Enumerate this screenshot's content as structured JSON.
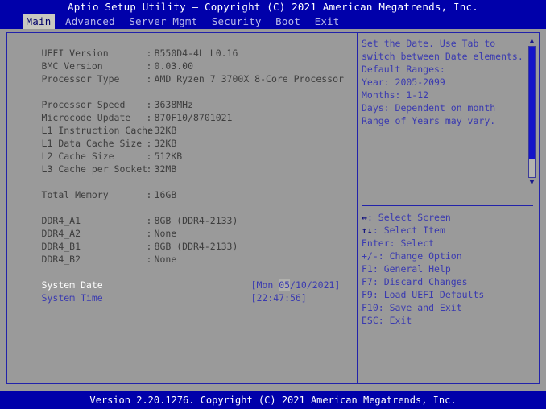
{
  "titlebar": {
    "text": "Aptio Setup Utility – Copyright (C) 2021 American Megatrends, Inc."
  },
  "menubar": {
    "items": [
      {
        "label": "Main",
        "active": true
      },
      {
        "label": "Advanced",
        "active": false
      },
      {
        "label": "Server Mgmt",
        "active": false
      },
      {
        "label": "Security",
        "active": false
      },
      {
        "label": "Boot",
        "active": false
      },
      {
        "label": "Exit",
        "active": false
      }
    ]
  },
  "main": {
    "info_rows": [
      {
        "label": "UEFI Version",
        "value": "B550D4-4L L0.16"
      },
      {
        "label": "BMC Version",
        "value": "0.03.00"
      },
      {
        "label": "Processor Type",
        "value": "AMD Ryzen 7 3700X 8-Core Processor"
      }
    ],
    "cpu_rows": [
      {
        "label": "Processor Speed",
        "value": "3638MHz"
      },
      {
        "label": "Microcode Update",
        "value": "870F10/8701021"
      },
      {
        "label": "L1 Instruction Cache",
        "value": "32KB"
      },
      {
        "label": "L1 Data Cache Size",
        "value": "32KB"
      },
      {
        "label": "L2 Cache Size",
        "value": "512KB"
      },
      {
        "label": "L3 Cache per Socket",
        "value": "32MB"
      }
    ],
    "memory_total": {
      "label": "Total Memory",
      "value": "16GB"
    },
    "dimm_rows": [
      {
        "label": "DDR4_A1",
        "value": "8GB (DDR4-2133)"
      },
      {
        "label": "DDR4_A2",
        "value": "None"
      },
      {
        "label": "DDR4_B1",
        "value": "8GB (DDR4-2133)"
      },
      {
        "label": "DDR4_B2",
        "value": "None"
      }
    ],
    "system_date": {
      "label": "System Date",
      "open_bracket": "[",
      "weekday": "Mon ",
      "month": "05",
      "rest": "/10/2021",
      "close_bracket": "]"
    },
    "system_time": {
      "label": "System Time",
      "value": "[22:47:56]"
    }
  },
  "help": {
    "lines": [
      "Set the Date. Use Tab to",
      "switch between Date elements.",
      "Default Ranges:",
      "Year: 2005-2099",
      "Months: 1-12",
      "Days: Dependent on month",
      "Range of Years may vary."
    ],
    "scroll_up_glyph": "▲",
    "scroll_down_glyph": "▼"
  },
  "keys": [
    {
      "glyph": "↔",
      "text": ": Select Screen"
    },
    {
      "glyph": "↑↓",
      "text": ": Select Item"
    },
    {
      "glyph": "",
      "text": "Enter: Select"
    },
    {
      "glyph": "",
      "text": "+/-: Change Option"
    },
    {
      "glyph": "",
      "text": "F1: General Help"
    },
    {
      "glyph": "",
      "text": "F7: Discard Changes"
    },
    {
      "glyph": "",
      "text": "F9: Load UEFI Defaults"
    },
    {
      "glyph": "",
      "text": "F10: Save and Exit"
    },
    {
      "glyph": "",
      "text": "ESC: Exit"
    }
  ],
  "footer": {
    "text": "Version 2.20.1276. Copyright (C) 2021 American Megatrends, Inc."
  },
  "colors": {
    "background": "#9a9a9a",
    "bar_blue": "#0000aa",
    "border_blue": "#2222aa",
    "text_blue": "#3a3ab0",
    "text_gray": "#3e3e3e",
    "active_white": "#ffffff",
    "tab_active_bg": "#c8c8c0",
    "scrollbar_thumb": "#1414c8"
  }
}
